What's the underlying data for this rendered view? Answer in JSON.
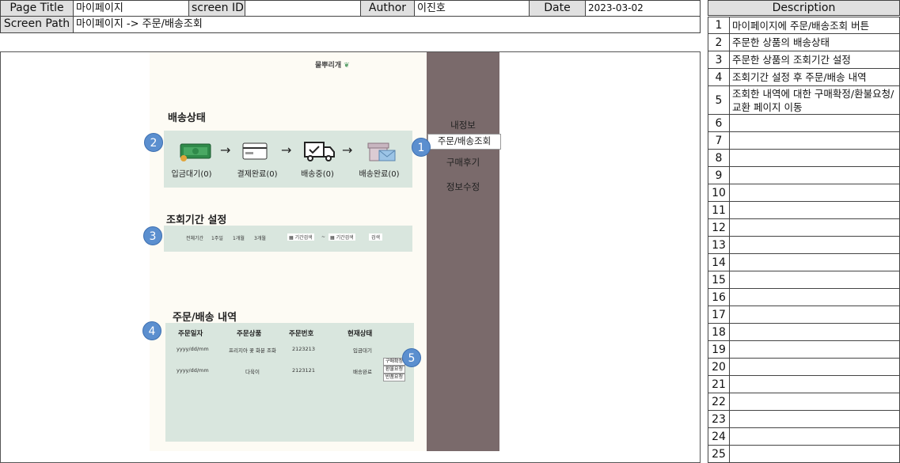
{
  "header": {
    "page_title_label": "Page Title",
    "page_title": "마이페이지",
    "screen_id_label": "screen ID",
    "screen_id": "",
    "author_label": "Author",
    "author": "이진호",
    "date_label": "Date",
    "date": "2023-03-02",
    "screen_path_label": "Screen Path",
    "screen_path": "마이페이지 -> 주문/배송조회"
  },
  "mockup": {
    "logo": "물뿌리개",
    "sidebar": [
      "내정보",
      "주문/배송조회",
      "구매후기",
      "정보수정"
    ],
    "delivery_title": "배송상태",
    "steps": [
      "입금대기(0)",
      "결제완료(0)",
      "배송중(0)",
      "배송완료(0)"
    ],
    "period_title": "조회기간 설정",
    "period": {
      "options": [
        "전체기간",
        "1주일",
        "1개월",
        "3개월"
      ],
      "from": "기간검색",
      "tilde": "~",
      "to": "기간검색",
      "search": "검색"
    },
    "orders_title": "주문/배송 내역",
    "columns": [
      "주문일자",
      "주문상품",
      "주문번호",
      "현재상태"
    ],
    "rows": [
      {
        "date": "yyyy/dd/mm",
        "product": "프리지아 꽃 화분 조화",
        "number": "2123213",
        "status": "입금대기"
      },
      {
        "date": "yyyy/dd/mm",
        "product": "다육이",
        "number": "2123121",
        "status": "배송완료"
      }
    ],
    "actions": [
      "구매확정",
      "환불요청",
      "반품요청"
    ],
    "badges": [
      "1",
      "2",
      "3",
      "4",
      "5"
    ]
  },
  "description": {
    "title": "Description",
    "rows": [
      {
        "n": "1",
        "text": "마이페이지에 주문/배송조회 버튼"
      },
      {
        "n": "2",
        "text": "주문한 상품의 배송상태"
      },
      {
        "n": "3",
        "text": "주문한 상품의 조회기간 설정"
      },
      {
        "n": "4",
        "text": "조회기간 설정 후 주문/배송 내역"
      },
      {
        "n": "5",
        "text": "조회한 내역에 대한 구매확정/환불요청/교환 페이지 이동"
      },
      {
        "n": "6",
        "text": ""
      },
      {
        "n": "7",
        "text": ""
      },
      {
        "n": "8",
        "text": ""
      },
      {
        "n": "9",
        "text": ""
      },
      {
        "n": "10",
        "text": ""
      },
      {
        "n": "11",
        "text": ""
      },
      {
        "n": "12",
        "text": ""
      },
      {
        "n": "13",
        "text": ""
      },
      {
        "n": "14",
        "text": ""
      },
      {
        "n": "15",
        "text": ""
      },
      {
        "n": "16",
        "text": ""
      },
      {
        "n": "17",
        "text": ""
      },
      {
        "n": "18",
        "text": ""
      },
      {
        "n": "19",
        "text": ""
      },
      {
        "n": "20",
        "text": ""
      },
      {
        "n": "21",
        "text": ""
      },
      {
        "n": "22",
        "text": ""
      },
      {
        "n": "23",
        "text": ""
      },
      {
        "n": "24",
        "text": ""
      },
      {
        "n": "25",
        "text": ""
      }
    ]
  }
}
